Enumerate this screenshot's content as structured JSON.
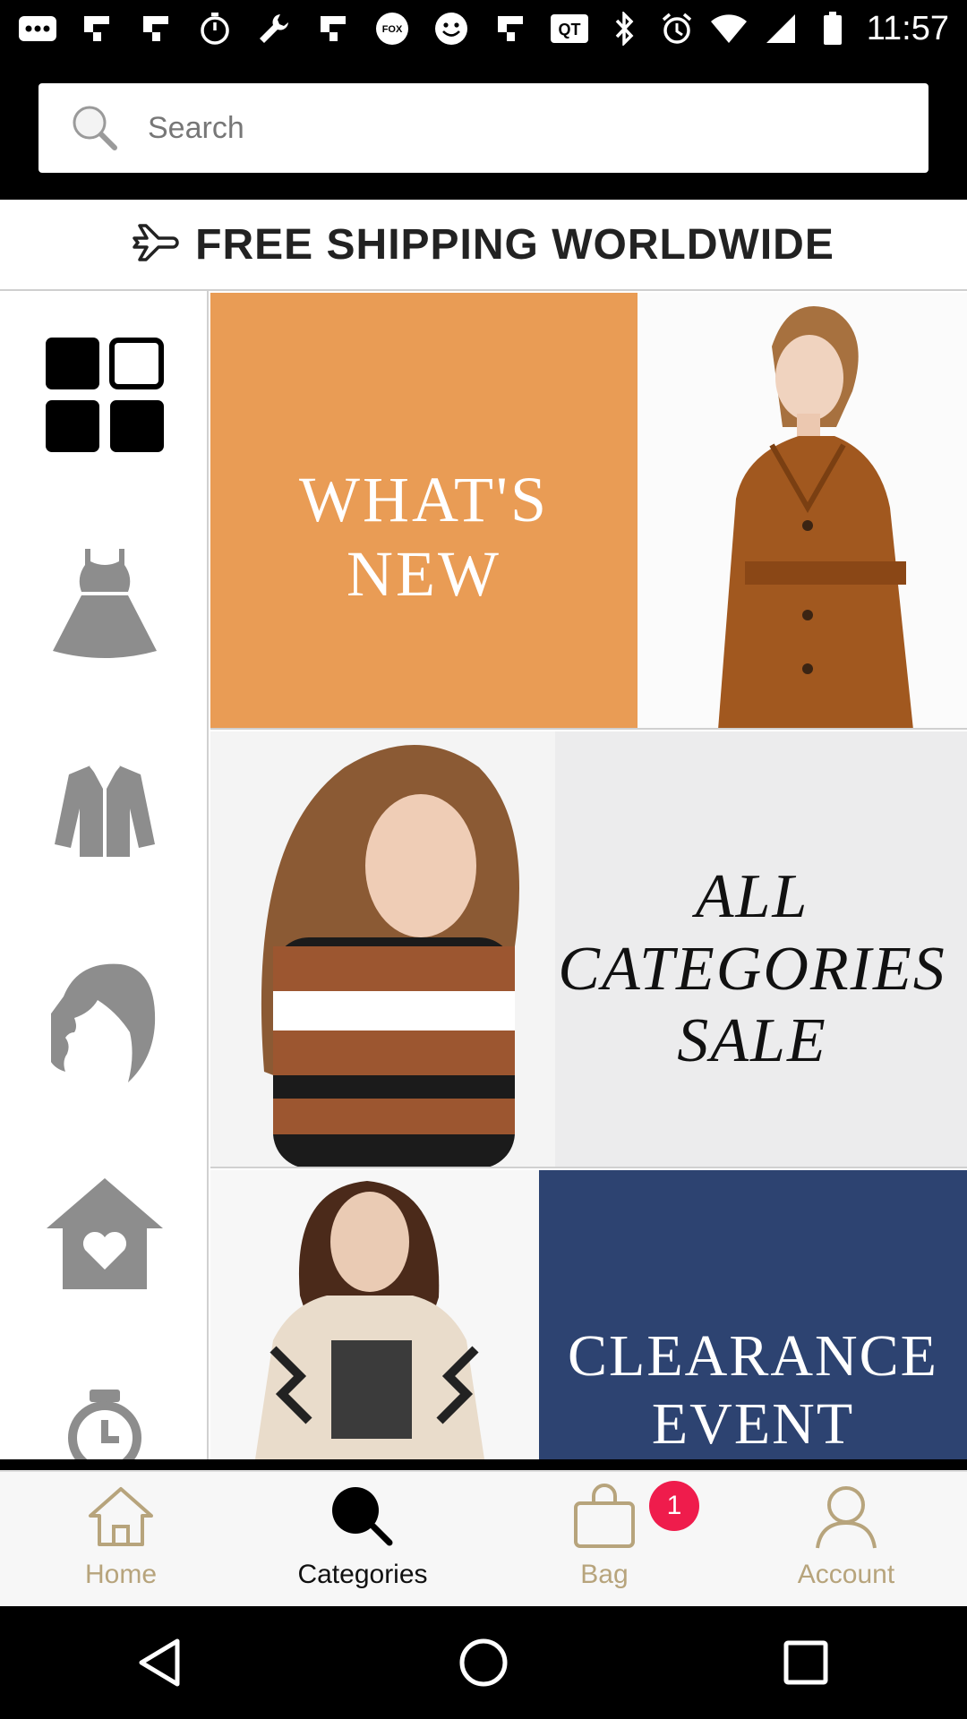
{
  "status_bar": {
    "time": "11:57",
    "left_icons": [
      "more-icon",
      "flipboard-icon",
      "flipboard-icon",
      "timer-icon",
      "wrench-icon",
      "flipboard-icon",
      "fox-sports-icon",
      "smiley-icon",
      "flipboard-icon",
      "qt-icon"
    ],
    "right_icons": [
      "bluetooth-icon",
      "alarm-icon",
      "wifi-icon",
      "signal-icon",
      "battery-icon"
    ]
  },
  "search": {
    "placeholder": "Search"
  },
  "banner": {
    "text": "FREE SHIPPING WORLDWIDE",
    "icon": "airplane-icon"
  },
  "sidebar": {
    "items": [
      {
        "name": "all-categories",
        "icon": "grid-icon"
      },
      {
        "name": "dresses",
        "icon": "dress-icon"
      },
      {
        "name": "jackets",
        "icon": "jacket-icon"
      },
      {
        "name": "beauty",
        "icon": "woman-profile-icon"
      },
      {
        "name": "home",
        "icon": "home-heart-icon"
      },
      {
        "name": "watches",
        "icon": "watch-icon"
      }
    ]
  },
  "tiles": {
    "whats_new": {
      "line1": "WHAT'S",
      "line2": "NEW"
    },
    "all_categories_sale": {
      "line1": "ALL",
      "line2": "CATEGORIES",
      "line3": "SALE"
    },
    "clearance": {
      "line1": "CLEARANCE",
      "line2": "EVENT"
    }
  },
  "bottom_nav": {
    "items": [
      {
        "label": "Home",
        "icon": "home-icon",
        "active": false
      },
      {
        "label": "Categories",
        "icon": "search-icon",
        "active": true
      },
      {
        "label": "Bag",
        "icon": "bag-icon",
        "active": false,
        "badge": "1"
      },
      {
        "label": "Account",
        "icon": "person-icon",
        "active": false
      }
    ]
  },
  "system_nav": [
    "back-icon",
    "home-circle-icon",
    "recents-icon"
  ],
  "colors": {
    "orange": "#e99c55",
    "navy": "#2d4371",
    "badge": "#ef1c4c",
    "nav_inactive": "#b7a47c"
  }
}
